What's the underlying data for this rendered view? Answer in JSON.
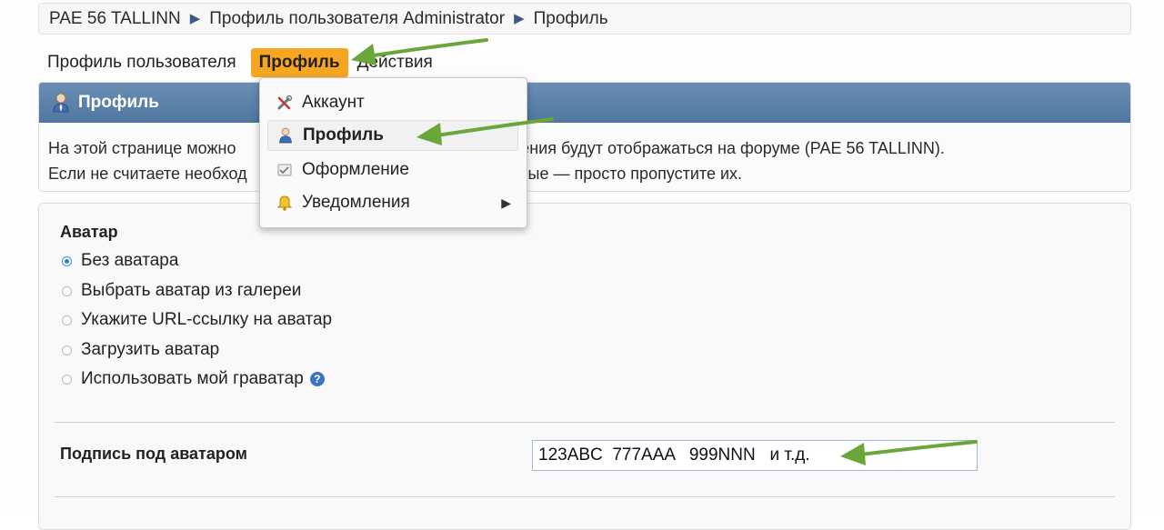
{
  "breadcrumb": {
    "items": [
      "PAE 56 TALLINN",
      "Профиль пользователя Administrator",
      "Профиль"
    ],
    "separator": "▶"
  },
  "tabs": [
    {
      "label": "Профиль пользователя",
      "active": false
    },
    {
      "label": "Профиль",
      "active": true
    },
    {
      "label": "Действия",
      "active": false
    }
  ],
  "panel": {
    "title": "Профиль",
    "text_line1_left": "На этой странице можно",
    "text_line1_right": "Эти сведения будут отображаться на форуме (PAE 56 TALLINN).",
    "text_line2_left": "Если не считаете необход",
    "text_line2_right": "нные — просто пропустите их."
  },
  "dropdown": {
    "items": [
      {
        "label": "Аккаунт",
        "icon": "tools-icon"
      },
      {
        "label": "Профиль",
        "icon": "user-icon",
        "highlighted": true
      },
      {
        "label": "Оформление",
        "icon": "appearance-icon"
      },
      {
        "label": "Уведомления",
        "icon": "bell-icon",
        "has_submenu": true
      }
    ],
    "submenu_arrow": "▶"
  },
  "avatar": {
    "title": "Аватар",
    "options": [
      {
        "label": "Без аватара",
        "checked": true
      },
      {
        "label": "Выбрать аватар из галереи",
        "checked": false
      },
      {
        "label": "Укажите URL-ссылку на аватар",
        "checked": false
      },
      {
        "label": "Загрузить аватар",
        "checked": false
      },
      {
        "label": "Использовать мой граватар",
        "checked": false,
        "help": "?"
      }
    ]
  },
  "signature": {
    "label": "Подпись под аватаром",
    "value": "123ABC  777AAA   999NNN   и т.д."
  },
  "colors": {
    "accent_tab": "#f6a623",
    "panel_header": "#5a7fa8",
    "annotation_arrow": "#6aa63a"
  }
}
